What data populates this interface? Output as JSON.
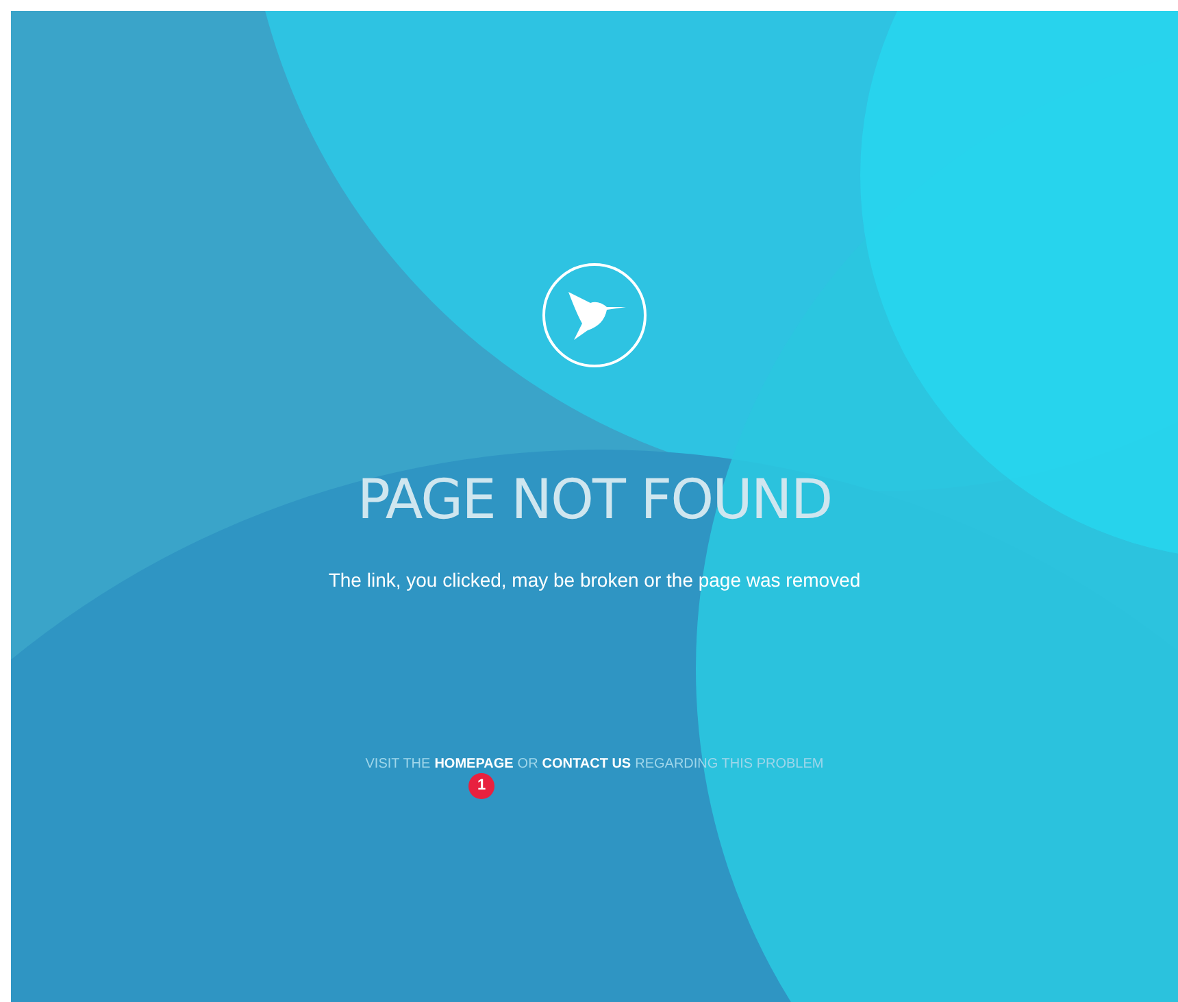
{
  "title": "PAGE NOT FOUND",
  "message": "The link, you clicked, may be broken or the page was removed",
  "footer": [
    {
      "kind": "text",
      "text": "VISIT THE"
    },
    {
      "kind": "link",
      "text": "HOMEPAGE"
    },
    {
      "kind": "text",
      "text": "OR"
    },
    {
      "kind": "link",
      "text": "CONTACT US"
    },
    {
      "kind": "text",
      "text": "REGARDING THIS PROBLEM"
    }
  ],
  "badge": "1"
}
